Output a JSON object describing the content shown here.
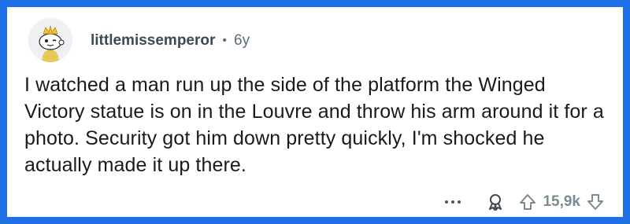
{
  "comment": {
    "username": "littlemissemperor",
    "separator": "•",
    "age": "6y",
    "text": "I watched a man run up the side of the platform the Winged Victory statue is on in the Louvre and throw his arm around it for a photo. Security got him down pretty quickly, I'm shocked he actually made it up there.",
    "score": "15,9k"
  },
  "icons": {
    "avatar": "snoo-avatar-icon",
    "more": "more-options-icon",
    "award": "award-icon",
    "upvote": "upvote-icon",
    "downvote": "downvote-icon"
  },
  "colors": {
    "border": "#1e6fe6",
    "meta": "#576f76",
    "text": "#1a1a1b"
  }
}
